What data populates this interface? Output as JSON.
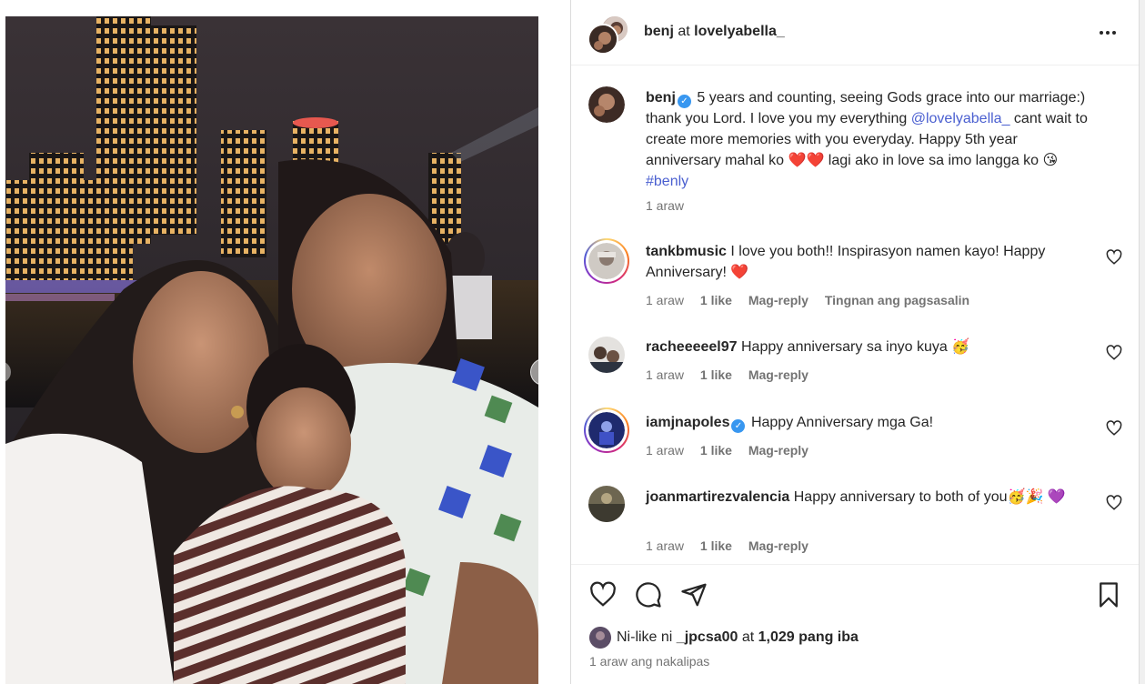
{
  "header": {
    "username": "benj",
    "at_text": "at",
    "location": "lovelyabella_"
  },
  "caption": {
    "user": "benj",
    "text_1": "5 years and counting, seeing Gods grace into our marriage:) thank you Lord. I love you my everything",
    "mention": "@lovelyabella_",
    "text_2": "cant wait to create more memories with you everyday. Happy 5th year anniversary mahal ko ❤️❤️ lagi ako in love sa imo langga ko 😘",
    "hashtag": "#benly",
    "time": "1 araw"
  },
  "comments": [
    {
      "user": "tankbmusic",
      "text": "I love you both!! Inspirasyon namen kayo! Happy Anniversary! ❤️",
      "time": "1 araw",
      "likes": "1 like",
      "reply": "Mag-reply",
      "translate": "Tingnan ang pagsasalin"
    },
    {
      "user": "racheeeeel97",
      "text": "Happy anniversary sa inyo kuya 🥳",
      "time": "1 araw",
      "likes": "1 like",
      "reply": "Mag-reply"
    },
    {
      "user": "iamjnapoles",
      "text": "Happy Anniversary mga Ga!",
      "time": "1 araw",
      "likes": "1 like",
      "reply": "Mag-reply"
    },
    {
      "user": "joanmartirezvalencia",
      "text": "Happy anniversary to both of you🥳🎉 💜",
      "time": "1 araw",
      "likes": "1 like",
      "reply": "Mag-reply"
    }
  ],
  "footer": {
    "liked_prefix": "Ni-like ni",
    "liked_user": "_jpcsa00",
    "liked_mid": "at",
    "liked_count": "1,029 pang iba",
    "time_ago": "1 araw ang nakalipas"
  },
  "colors": {
    "link": "#4a5fd0",
    "verified": "#3897f0",
    "muted": "#737373",
    "heart_red": "#ed1c3a"
  }
}
